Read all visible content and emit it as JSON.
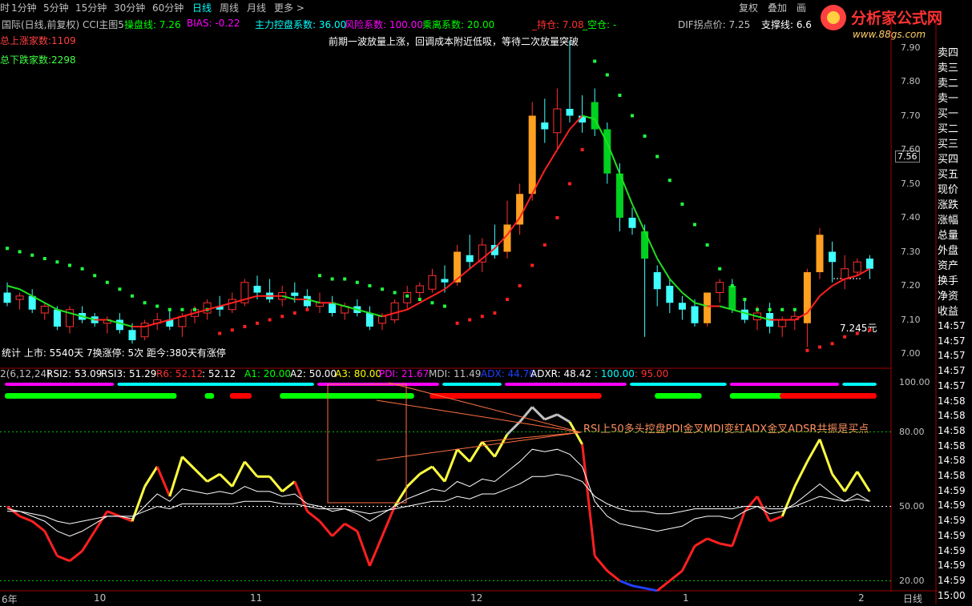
{
  "toolbar": {
    "items": [
      "时",
      "1分钟",
      "5分钟",
      "15分钟",
      "30分钟",
      "60分钟",
      "日线",
      "周线",
      "月线",
      "更多 >"
    ],
    "active_index": 6,
    "right_buttons": [
      "复权",
      "叠加",
      "画"
    ]
  },
  "watermark": {
    "brand": "分析家公式网",
    "url": "www.88gs.com"
  },
  "legend_top": [
    {
      "text": "国际(日线,前复权) CCI主图5",
      "color": "#c0c0c0"
    },
    {
      "text": "操盘线: 7.26",
      "color": "#00ff00"
    },
    {
      "text": "BIAS: -0.22",
      "color": "#ff00ff"
    },
    {
      "text": "主力控盘系数: 36.00",
      "color": "#00ffff"
    },
    {
      "text": "风险系数: 100.00",
      "color": "#ff00ff"
    },
    {
      "text": "乘离系数: 20.00",
      "color": "#00ff00"
    },
    {
      "text": "_持仓: 7.08",
      "color": "#ff3030"
    },
    {
      "text": "_空仓: -",
      "color": "#00ff00"
    },
    {
      "text": "DIF拐点价: 7.25",
      "color": "#c0c0c0"
    },
    {
      "text": "支撑线: 6.6",
      "color": "#ffffff"
    }
  ],
  "stats": {
    "up_count": "总上涨家数:1109",
    "down_count": "总下跌家数:2298",
    "note": "前期一波放量上涨，回调成本附近低吸，等待二次放量突破",
    "bottom_stats": "统计 上市: 5540天 7换涨停: 5次  距今:380天有涨停",
    "last_price_label": "7.245元",
    "price_tag": "7.56"
  },
  "price_axis": [
    "7.90",
    "7.80",
    "7.70",
    "7.60",
    "7.50",
    "7.40",
    "7.30",
    "7.20",
    "7.10",
    "7.00"
  ],
  "indicator_axis": [
    "100.00",
    "80.00",
    "50.00",
    "20.00"
  ],
  "legend_ind": [
    {
      "text": "2(6,12,24)",
      "color": "#c0c0c0"
    },
    {
      "text": "RSI2: 53.09",
      "color": "#ffffff"
    },
    {
      "text": "RSI3: 51.29",
      "color": "#ffffff"
    },
    {
      "text": "R6: 52.12",
      "color": "#ff3030"
    },
    {
      "text": ": 52.12",
      "color": "#ffffff"
    },
    {
      "text": "A1: 20.00",
      "color": "#00ff00"
    },
    {
      "text": "A2: 50.00",
      "color": "#ffffff"
    },
    {
      "text": "A3: 80.00",
      "color": "#ffff00"
    },
    {
      "text": "PDI: 21.67",
      "color": "#ff00ff"
    },
    {
      "text": "MDI: 11.49",
      "color": "#c0c0c0"
    },
    {
      "text": "ADX: 44.70",
      "color": "#2040ff"
    },
    {
      "text": "ADXR: 48.42",
      "color": "#ffffff"
    },
    {
      "text": ": 100.00",
      "color": "#00ffff"
    },
    {
      "text": ": 95.00",
      "color": "#ff3030"
    }
  ],
  "annotation": "RSI上50多头控盘PDI金叉MDI变红ADX金叉ADSR共振是买点",
  "x_axis": [
    "6年",
    "10",
    "11",
    "12",
    "1",
    "2"
  ],
  "period_label": "日线",
  "sidebar": [
    "卖四",
    "卖三",
    "卖二",
    "卖一",
    "买一",
    "买二",
    "买三",
    "买四",
    "买五",
    "现价",
    "涨跌",
    "涨幅",
    "总量",
    "外盘",
    "资产",
    "换手",
    "净资",
    "收益"
  ],
  "time_list": [
    "14:57",
    "14:57",
    "14:57",
    "14:57",
    "14:57",
    "14:58",
    "14:58",
    "14:58",
    "14:58",
    "14:58",
    "14:58",
    "14:59",
    "14:59",
    "14:59",
    "14:59",
    "14:59",
    "14:59",
    "14:59",
    "15:00"
  ],
  "colors": {
    "up": "#ff3030",
    "down": "#00ffff",
    "accent": "#ffff00"
  },
  "chart_data": {
    "type": "line",
    "title": "",
    "price_range": [
      7.0,
      7.95
    ],
    "indicator_range": [
      15,
      103
    ],
    "price_ticks": [
      7.9,
      7.8,
      7.7,
      7.6,
      7.5,
      7.4,
      7.3,
      7.2,
      7.1,
      7.0
    ],
    "indicator_ticks": [
      100,
      80,
      50,
      20
    ],
    "bars": 70,
    "x_labels_at": [
      0,
      13,
      23,
      35,
      51,
      64
    ],
    "ohlc": [
      [
        7.18,
        7.21,
        7.14,
        7.15
      ],
      [
        7.16,
        7.18,
        7.13,
        7.17
      ],
      [
        7.17,
        7.19,
        7.12,
        7.13
      ],
      [
        7.12,
        7.15,
        7.1,
        7.14
      ],
      [
        7.13,
        7.14,
        7.07,
        7.08
      ],
      [
        7.08,
        7.14,
        7.06,
        7.13
      ],
      [
        7.12,
        7.14,
        7.09,
        7.1
      ],
      [
        7.11,
        7.12,
        7.08,
        7.09
      ],
      [
        7.09,
        7.11,
        7.06,
        7.1
      ],
      [
        7.1,
        7.12,
        7.06,
        7.07
      ],
      [
        7.07,
        7.09,
        7.03,
        7.04
      ],
      [
        7.05,
        7.1,
        7.04,
        7.09
      ],
      [
        7.09,
        7.12,
        7.07,
        7.1
      ],
      [
        7.1,
        7.13,
        7.07,
        7.08
      ],
      [
        7.08,
        7.12,
        7.05,
        7.11
      ],
      [
        7.11,
        7.14,
        7.09,
        7.13
      ],
      [
        7.12,
        7.16,
        7.1,
        7.15
      ],
      [
        7.14,
        7.17,
        7.11,
        7.13
      ],
      [
        7.13,
        7.18,
        7.12,
        7.16
      ],
      [
        7.15,
        7.22,
        7.14,
        7.21
      ],
      [
        7.2,
        7.23,
        7.16,
        7.18
      ],
      [
        7.18,
        7.22,
        7.15,
        7.16
      ],
      [
        7.16,
        7.2,
        7.14,
        7.18
      ],
      [
        7.18,
        7.21,
        7.15,
        7.17
      ],
      [
        7.17,
        7.19,
        7.13,
        7.14
      ],
      [
        7.14,
        7.18,
        7.12,
        7.15
      ],
      [
        7.15,
        7.17,
        7.11,
        7.12
      ],
      [
        7.12,
        7.15,
        7.1,
        7.14
      ],
      [
        7.14,
        7.16,
        7.11,
        7.12
      ],
      [
        7.12,
        7.14,
        7.07,
        7.08
      ],
      [
        7.09,
        7.12,
        7.07,
        7.11
      ],
      [
        7.1,
        7.16,
        7.09,
        7.15
      ],
      [
        7.15,
        7.2,
        7.13,
        7.18
      ],
      [
        7.18,
        7.21,
        7.16,
        7.2
      ],
      [
        7.19,
        7.25,
        7.18,
        7.23
      ],
      [
        7.22,
        7.26,
        7.18,
        7.21
      ],
      [
        7.21,
        7.32,
        7.2,
        7.3
      ],
      [
        7.29,
        7.35,
        7.25,
        7.27
      ],
      [
        7.27,
        7.34,
        7.24,
        7.32
      ],
      [
        7.32,
        7.38,
        7.28,
        7.29
      ],
      [
        7.3,
        7.45,
        7.28,
        7.38
      ],
      [
        7.38,
        7.5,
        7.35,
        7.47
      ],
      [
        7.47,
        7.74,
        7.45,
        7.7
      ],
      [
        7.68,
        7.75,
        7.62,
        7.66
      ],
      [
        7.65,
        7.78,
        7.6,
        7.72
      ],
      [
        7.72,
        7.92,
        7.68,
        7.7
      ],
      [
        7.7,
        7.76,
        7.65,
        7.68
      ],
      [
        7.74,
        7.78,
        7.64,
        7.66
      ],
      [
        7.66,
        7.68,
        7.5,
        7.53
      ],
      [
        7.53,
        7.56,
        7.36,
        7.4
      ],
      [
        7.4,
        7.43,
        7.35,
        7.37
      ],
      [
        7.36,
        7.38,
        7.05,
        7.28
      ],
      [
        7.24,
        7.26,
        7.14,
        7.19
      ],
      [
        7.2,
        7.22,
        7.12,
        7.15
      ],
      [
        7.15,
        7.17,
        7.1,
        7.13
      ],
      [
        7.14,
        7.16,
        7.08,
        7.09
      ],
      [
        7.09,
        7.18,
        7.08,
        7.18
      ],
      [
        7.18,
        7.22,
        7.15,
        7.21
      ],
      [
        7.2,
        7.22,
        7.12,
        7.13
      ],
      [
        7.13,
        7.16,
        7.09,
        7.1
      ],
      [
        7.1,
        7.14,
        7.07,
        7.12
      ],
      [
        7.12,
        7.15,
        7.06,
        7.08
      ],
      [
        7.08,
        7.11,
        7.05,
        7.1
      ],
      [
        7.1,
        7.13,
        7.07,
        7.11
      ],
      [
        7.09,
        7.25,
        7.02,
        7.24
      ],
      [
        7.24,
        7.37,
        7.22,
        7.35
      ],
      [
        7.3,
        7.33,
        7.21,
        7.27
      ],
      [
        7.22,
        7.29,
        7.19,
        7.25
      ],
      [
        7.24,
        7.28,
        7.23,
        7.27
      ],
      [
        7.28,
        7.29,
        7.22,
        7.25
      ]
    ],
    "ma": [
      7.2,
      7.19,
      7.17,
      7.15,
      7.13,
      7.12,
      7.11,
      7.1,
      7.1,
      7.09,
      7.08,
      7.08,
      7.09,
      7.1,
      7.11,
      7.12,
      7.13,
      7.14,
      7.15,
      7.16,
      7.17,
      7.17,
      7.17,
      7.16,
      7.16,
      7.15,
      7.15,
      7.14,
      7.13,
      7.12,
      7.11,
      7.12,
      7.13,
      7.15,
      7.17,
      7.19,
      7.22,
      7.25,
      7.28,
      7.31,
      7.35,
      7.4,
      7.47,
      7.54,
      7.6,
      7.66,
      7.7,
      7.69,
      7.62,
      7.53,
      7.44,
      7.36,
      7.28,
      7.22,
      7.18,
      7.15,
      7.14,
      7.14,
      7.13,
      7.12,
      7.11,
      7.1,
      7.1,
      7.1,
      7.12,
      7.17,
      7.2,
      7.22,
      7.23,
      7.25
    ],
    "support_dots": [
      [
        0,
        7.31
      ],
      [
        1,
        7.3
      ],
      [
        2,
        7.29
      ],
      [
        3,
        7.28
      ],
      [
        4,
        7.27
      ],
      [
        5,
        7.26
      ],
      [
        6,
        7.25
      ],
      [
        7,
        7.23
      ],
      [
        8,
        7.21
      ],
      [
        9,
        7.19
      ],
      [
        10,
        7.17
      ],
      [
        11,
        7.15
      ],
      [
        12,
        7.14
      ],
      [
        13,
        7.13
      ],
      [
        14,
        7.13
      ],
      [
        15,
        7.13
      ],
      [
        16,
        7.13
      ],
      [
        17,
        7.06
      ],
      [
        18,
        7.07
      ],
      [
        19,
        7.08
      ],
      [
        20,
        7.09
      ],
      [
        21,
        7.1
      ],
      [
        22,
        7.11
      ],
      [
        23,
        7.12
      ],
      [
        24,
        7.13
      ],
      [
        25,
        7.23
      ],
      [
        26,
        7.22
      ],
      [
        27,
        7.22
      ],
      [
        28,
        7.21
      ],
      [
        29,
        7.2
      ],
      [
        30,
        7.19
      ],
      [
        31,
        7.18
      ],
      [
        32,
        7.17
      ],
      [
        33,
        7.16
      ],
      [
        34,
        7.15
      ],
      [
        35,
        7.14
      ],
      [
        36,
        7.09
      ],
      [
        37,
        7.1
      ],
      [
        38,
        7.11
      ],
      [
        39,
        7.12
      ],
      [
        40,
        7.16
      ],
      [
        41,
        7.2
      ],
      [
        42,
        7.26
      ],
      [
        43,
        7.32
      ],
      [
        44,
        7.4
      ],
      [
        45,
        7.5
      ],
      [
        46,
        7.6
      ],
      [
        47,
        7.86
      ],
      [
        48,
        7.82
      ],
      [
        49,
        7.76
      ],
      [
        50,
        7.7
      ],
      [
        51,
        7.64
      ],
      [
        52,
        7.58
      ],
      [
        53,
        7.51
      ],
      [
        54,
        7.44
      ],
      [
        55,
        7.38
      ],
      [
        56,
        7.32
      ],
      [
        57,
        7.25
      ],
      [
        58,
        7.2
      ],
      [
        59,
        7.16
      ],
      [
        60,
        7.13
      ],
      [
        61,
        7.13
      ],
      [
        62,
        7.13
      ],
      [
        63,
        7.13
      ],
      [
        64,
        7.01
      ],
      [
        65,
        7.02
      ],
      [
        66,
        7.03
      ],
      [
        67,
        7.05
      ],
      [
        68,
        7.06
      ],
      [
        69,
        7.07
      ]
    ],
    "series": [
      {
        "name": "R6",
        "values": [
          50,
          46,
          44,
          40,
          30,
          28,
          32,
          40,
          48,
          46,
          44,
          58,
          66,
          54,
          70,
          65,
          60,
          63,
          58,
          68,
          62,
          62,
          56,
          60,
          48,
          44,
          38,
          43,
          40,
          26,
          38,
          50,
          58,
          63,
          66,
          60,
          73,
          68,
          76,
          70,
          79,
          84,
          90,
          85,
          87,
          84,
          75,
          30,
          24,
          20,
          18,
          17,
          16,
          20,
          24,
          34,
          37,
          35,
          34,
          48,
          54,
          44,
          46,
          58,
          68,
          77,
          63,
          56,
          64,
          56
        ]
      },
      {
        "name": "RSI2",
        "values": [
          49,
          48,
          46,
          44,
          40,
          38,
          40,
          43,
          46,
          46,
          45,
          50,
          55,
          52,
          57,
          56,
          55,
          56,
          55,
          58,
          56,
          56,
          54,
          55,
          51,
          50,
          48,
          49,
          47,
          44,
          47,
          50,
          53,
          55,
          57,
          56,
          60,
          58,
          61,
          60,
          64,
          68,
          73,
          72,
          73,
          71,
          66,
          52,
          46,
          43,
          42,
          41,
          40,
          41,
          42,
          45,
          46,
          46,
          45,
          48,
          50,
          47,
          48,
          51,
          55,
          59,
          55,
          52,
          55,
          52
        ]
      },
      {
        "name": "RSI3",
        "values": [
          48,
          48,
          47,
          46,
          44,
          43,
          44,
          45,
          46,
          46,
          46,
          48,
          50,
          49,
          51,
          51,
          51,
          51,
          51,
          52,
          52,
          52,
          51,
          51,
          50,
          49,
          49,
          49,
          48,
          47,
          48,
          49,
          50,
          51,
          52,
          52,
          54,
          53,
          55,
          55,
          57,
          59,
          62,
          62,
          63,
          62,
          60,
          54,
          51,
          49,
          48,
          48,
          47,
          47,
          48,
          49,
          49,
          49,
          49,
          50,
          50,
          49,
          49,
          50,
          52,
          54,
          53,
          52,
          53,
          52
        ]
      }
    ],
    "levels": {
      "A1": 20,
      "A2": 50,
      "A3": 80
    },
    "strips": [
      {
        "color": "#ff00ff",
        "segments": [
          [
            0,
            9
          ],
          [
            25,
            35
          ],
          [
            40,
            50
          ],
          [
            58,
            67
          ]
        ]
      },
      {
        "color": "#00ffff",
        "segments": [
          [
            9,
            25
          ],
          [
            35,
            40
          ],
          [
            50,
            58
          ],
          [
            67,
            70
          ]
        ]
      },
      {
        "color": "#00ff00",
        "segments": [
          [
            0,
            14
          ],
          [
            16,
            17
          ],
          [
            22,
            33
          ],
          [
            52,
            56
          ],
          [
            58,
            63
          ]
        ]
      },
      {
        "color": "#ff0000",
        "segments": [
          [
            18,
            20
          ],
          [
            34,
            48
          ],
          [
            62,
            70
          ]
        ]
      }
    ]
  }
}
